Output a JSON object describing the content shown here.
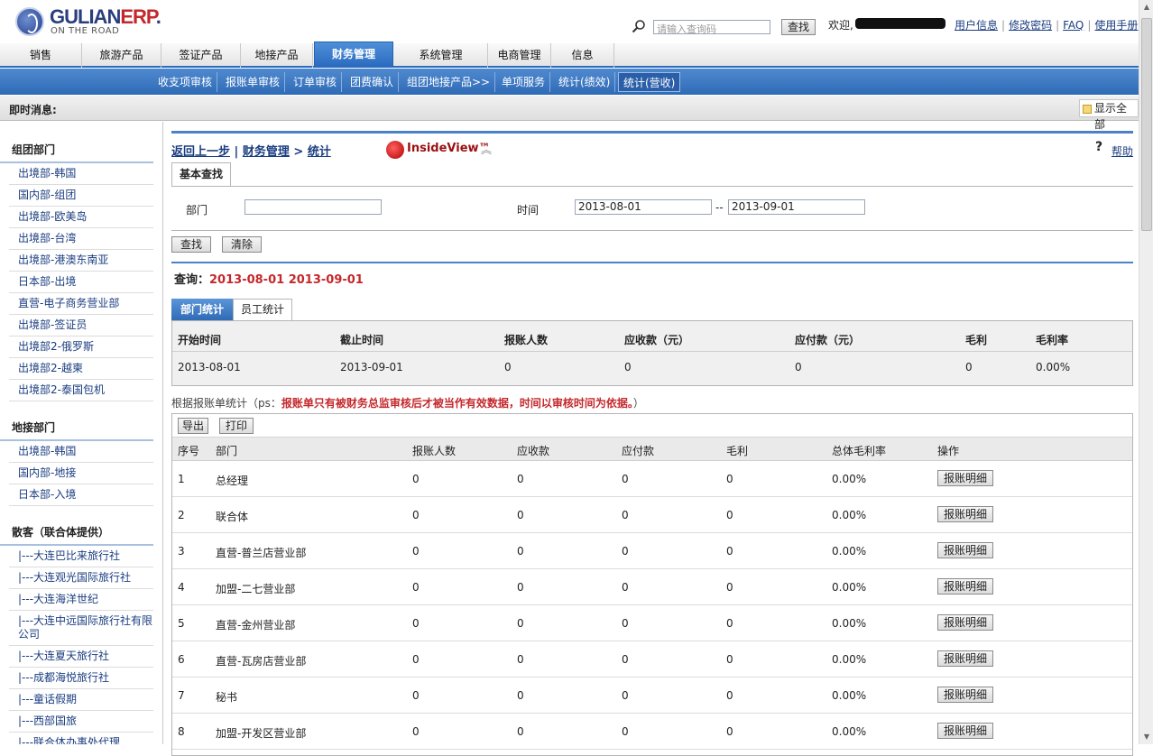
{
  "header": {
    "logo_main": "GULIAN",
    "logo_accent": "ERP",
    "logo_mark": ".",
    "logo_sub": "ON THE ROAD",
    "search_placeholder": "请输入查询码",
    "search_button": "查找",
    "welcome": "欢迎,",
    "links": [
      "用户信息",
      "修改密码",
      "FAQ",
      "使用手册"
    ]
  },
  "nav": {
    "items": [
      "销售",
      "旅游产品",
      "签证产品",
      "地接产品",
      "财务管理",
      "系统管理",
      "电商管理",
      "信息"
    ],
    "active": "财务管理"
  },
  "subnav": {
    "items": [
      "收支项审核",
      "报账单审核",
      "订单审核",
      "团费确认",
      "组团地接产品>>",
      "单项服务",
      "统计(绩效)",
      "统计(营收)"
    ]
  },
  "notice": {
    "label": "即时消息:",
    "show_all": "显示全部"
  },
  "sidebar": {
    "groups": [
      {
        "title": "组团部门",
        "items": [
          "出境部-韩国",
          "国内部-组团",
          "出境部-欧美岛",
          "出境部-台湾",
          "出境部-港澳东南亚",
          "日本部-出境",
          "直营-电子商务营业部",
          "出境部-签证员",
          "出境部2-俄罗斯",
          "出境部2-越柬",
          "出境部2-泰国包机"
        ]
      },
      {
        "title": "地接部门",
        "items": [
          "出境部-韩国",
          "国内部-地接",
          "日本部-入境"
        ]
      },
      {
        "title": "散客（联合体提供）",
        "items": [
          "|---大连巴比来旅行社",
          "|---大连观光国际旅行社",
          "|---大连海洋世纪",
          "|---大连中远国际旅行社有限公司",
          "|---大连夏天旅行社",
          "|---成都海悦旅行社",
          "|---童话假期",
          "|---西部国旅",
          "|---联合体办事处代理"
        ]
      }
    ]
  },
  "content": {
    "breadcrumb": {
      "back": "返回上一步",
      "sep": "|",
      "section": "财务管理",
      "arrow": ">",
      "page": "统计"
    },
    "insideview": "InsideView™",
    "help_q": "?",
    "help": "帮助",
    "tab_basic": "基本查找",
    "form": {
      "dept_label": "部门",
      "dept_value": "",
      "time_label": "时间",
      "date_from": "2013-08-01",
      "date_sep": "--",
      "date_to": "2013-09-01",
      "search_button": "查找",
      "clear_button": "清除"
    },
    "query": {
      "label": "查询：",
      "value": "2013-08-01 2013-09-01"
    },
    "tabs": [
      "部门统计",
      "员工统计"
    ],
    "summary": {
      "headers": [
        "开始时间",
        "截止时间",
        "报账人数",
        "应收款（元）",
        "应付款（元）",
        "毛利",
        "毛利率"
      ],
      "values": [
        "2013-08-01",
        "2013-09-01",
        "0",
        "0",
        "0",
        "0",
        "0.00%"
      ]
    },
    "note_prefix": "根据报账单统计（ps：",
    "note_red": "报账单只有被财务总监审核后才被当作有效数据，时间以审核时间为依据。",
    "note_suffix": "）",
    "toolbar": {
      "export": "导出",
      "print": "打印"
    },
    "table": {
      "headers": [
        "序号",
        "部门",
        "报账人数",
        "应收款",
        "应付款",
        "毛利",
        "总体毛利率",
        "操作"
      ],
      "action_label": "报账明细",
      "rows": [
        [
          "1",
          "总经理",
          "0",
          "0",
          "0",
          "0",
          "0.00%"
        ],
        [
          "2",
          "联合体",
          "0",
          "0",
          "0",
          "0",
          "0.00%"
        ],
        [
          "3",
          "直营-普兰店营业部",
          "0",
          "0",
          "0",
          "0",
          "0.00%"
        ],
        [
          "4",
          "加盟-二七营业部",
          "0",
          "0",
          "0",
          "0",
          "0.00%"
        ],
        [
          "5",
          "直营-金州营业部",
          "0",
          "0",
          "0",
          "0",
          "0.00%"
        ],
        [
          "6",
          "直营-瓦房店营业部",
          "0",
          "0",
          "0",
          "0",
          "0.00%"
        ],
        [
          "7",
          "秘书",
          "0",
          "0",
          "0",
          "0",
          "0.00%"
        ],
        [
          "8",
          "加盟-开发区营业部",
          "0",
          "0",
          "0",
          "0",
          "0.00%"
        ]
      ]
    }
  }
}
